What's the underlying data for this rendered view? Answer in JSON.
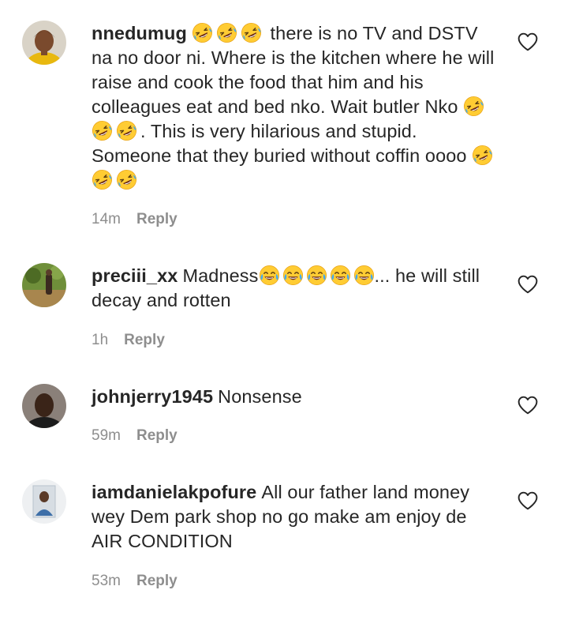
{
  "reply_label": "Reply",
  "comments": [
    {
      "username": "nnedumug",
      "segments": [
        " there is no TV and DSTV na no door ni. Where is the kitchen where he will raise and cook the food that him and his colleagues eat and bed nko. Wait butler Nko ",
        ". This is very hilarious and stupid. Someone that they buried without coffin oooo "
      ],
      "emoji_1": "rolling-on-floor-laughing",
      "emoji_2": "face-with-tears-of-joy",
      "time": "14m"
    },
    {
      "username": "preciii_xx",
      "text_before": "Madness",
      "text_after": "... he will still decay and rotten",
      "time": "1h"
    },
    {
      "username": "johnjerry1945",
      "text": "Nonsense",
      "time": "59m"
    },
    {
      "username": "iamdanielakpofure",
      "text": "All our father land money wey Dem park shop no go make am enjoy de AIR CONDITION",
      "time": "53m"
    }
  ]
}
